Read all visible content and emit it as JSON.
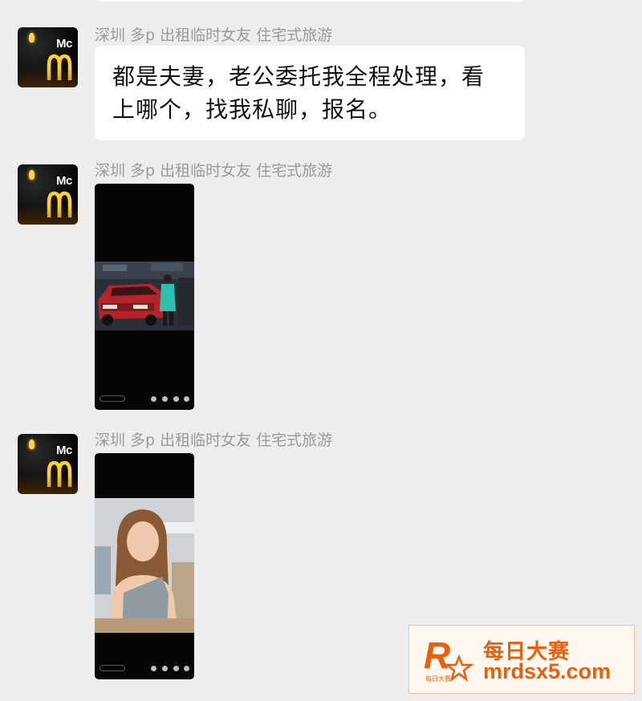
{
  "messages": [
    {
      "sender": "深圳 多p 出租临时女友 住宅式旅游",
      "type": "text",
      "text_line1": "都是夫妻，老公委托我全程处理，看",
      "text_line2": "上哪个，找我私聊，报名。"
    },
    {
      "sender": "深圳 多p 出租临时女友 住宅式旅游",
      "type": "video-screenshot",
      "image_subject": "woman standing beside a red SUV"
    },
    {
      "sender": "深圳 多p 出租临时女友 住宅式旅游",
      "type": "video-screenshot",
      "image_subject": "selfie of a woman in a grey top"
    }
  ],
  "avatar": {
    "icon": "golden-arches-logo-icon",
    "text": "Mc"
  },
  "watermark": {
    "logo_letter": "R",
    "logo_sub": "每日大赛",
    "title": "每日大赛",
    "url": "mrdsx5.com",
    "accent": "#e8600c"
  }
}
